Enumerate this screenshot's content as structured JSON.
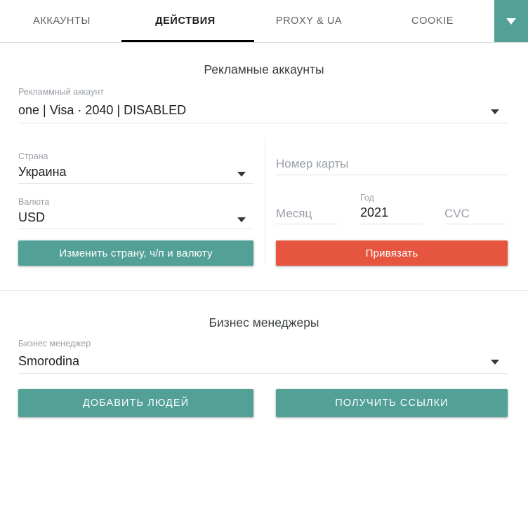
{
  "tabbar": {
    "tabs": [
      {
        "label": "АККАУНТЫ",
        "active": false
      },
      {
        "label": "ДЕЙСТВИЯ",
        "active": true
      },
      {
        "label": "PROXY & UA",
        "active": false
      },
      {
        "label": "COOKIE",
        "active": false
      }
    ],
    "more_icon": "chevron-down-icon",
    "more_bg_color": "#52a096",
    "active_indicator_color": "#000000"
  },
  "ad_accounts": {
    "title": "Рекламные аккаунты",
    "account_select": {
      "label": "Рекламмный аккаунт",
      "value": "one | Visa · 2040 | DISABLED",
      "arrow_icon": "triangle-down-icon"
    },
    "country_select": {
      "label": "Страна",
      "value": "Украина",
      "arrow_icon": "triangle-down-icon"
    },
    "currency_select": {
      "label": "Валюта",
      "value": "USD",
      "arrow_icon": "triangle-down-icon"
    },
    "card_number": {
      "label": "",
      "value": "",
      "placeholder": "Номер карты"
    },
    "card_month": {
      "label": "",
      "value": "",
      "placeholder": "Месяц"
    },
    "card_year": {
      "label": "Год",
      "value": "2021",
      "placeholder": ""
    },
    "card_cvc": {
      "label": "",
      "value": "",
      "placeholder": "CVC"
    },
    "change_button": {
      "label": "Изменить страну, ч/п и валюту",
      "color": "#52a096"
    },
    "bind_button": {
      "label": "Привязать",
      "color": "#e5553f"
    }
  },
  "business_managers": {
    "title": "Бизнес менеджеры",
    "bm_select": {
      "label": "Бизнес менеджер",
      "value": "Smorodina",
      "arrow_icon": "triangle-down-icon"
    },
    "add_people_button": {
      "label": "ДОБАВИТЬ ЛЮДЕЙ",
      "color": "#52a096"
    },
    "get_links_button": {
      "label": "ПОЛУЧИТЬ ССЫЛКИ",
      "color": "#52a096"
    }
  }
}
